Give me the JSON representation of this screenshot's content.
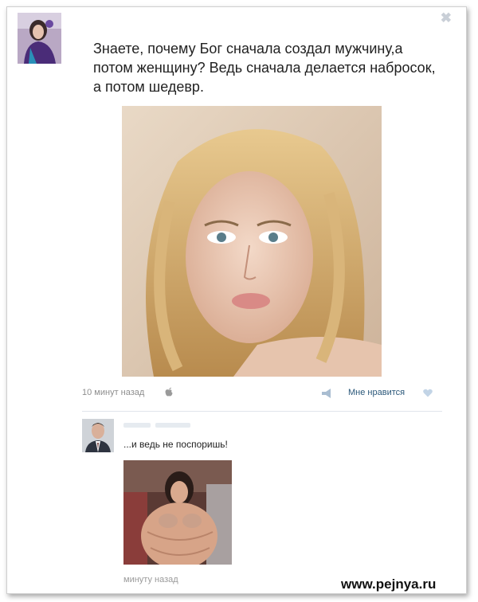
{
  "post": {
    "text": "Знаете, почему Бог сначала создал мужчину,а потом женщину? Ведь сначала делается набросок, а потом шедевр.",
    "time": "10 минут назад",
    "like_label": "Мне нравится",
    "close_icon": "close-icon"
  },
  "reply": {
    "text": "...и ведь не поспоришь!",
    "time": "минуту назад"
  },
  "watermark": "www.pejnya.ru",
  "colors": {
    "link": "#2b587a",
    "muted": "#8e8e8e",
    "icon": "#a9bdd1",
    "heart": "#c2d4e6"
  }
}
